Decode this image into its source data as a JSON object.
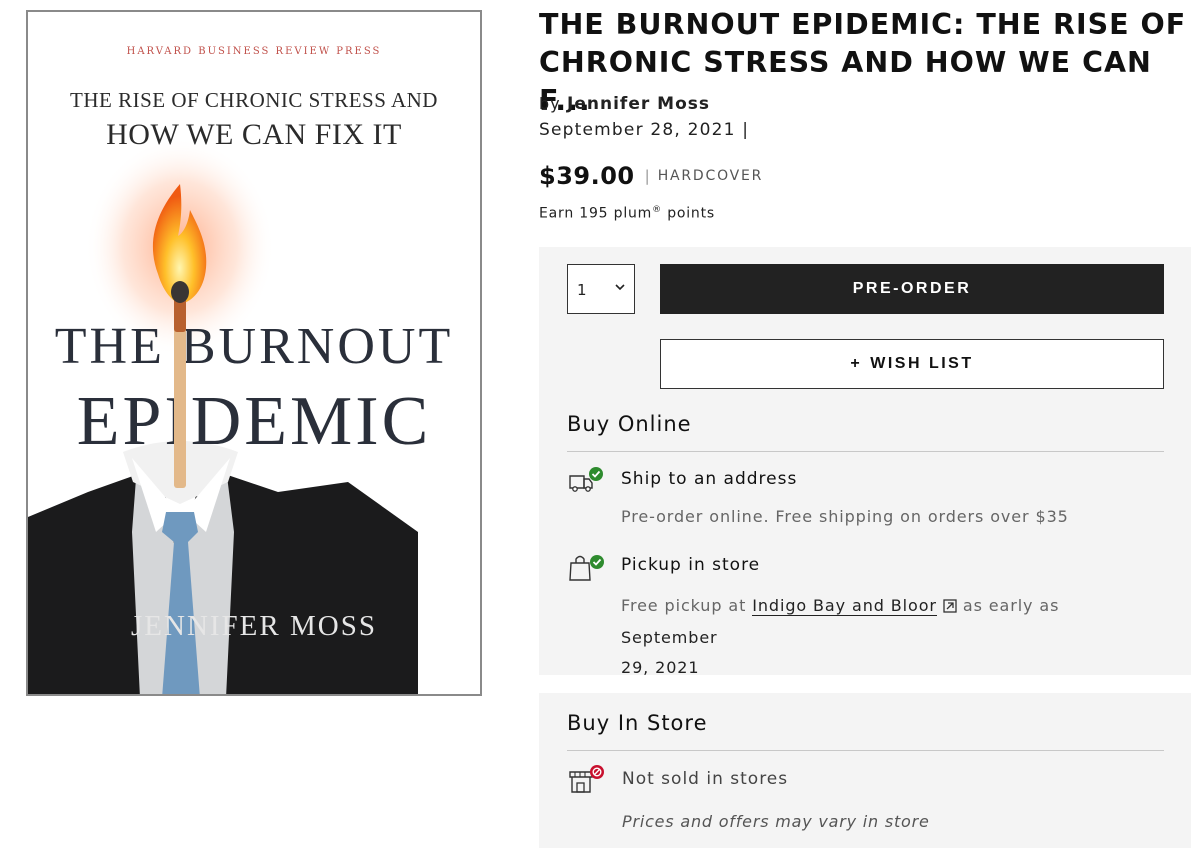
{
  "cover": {
    "publisher": "HARVARD BUSINESS REVIEW PRESS",
    "subtitle_line1": "THE RISE OF CHRONIC STRESS AND",
    "subtitle_line2": "HOW WE CAN FIX IT",
    "title_line1": "THE BURNOUT",
    "title_line2": "EPIDEMIC",
    "author": "JENNIFER MOSS"
  },
  "product": {
    "title": "THE BURNOUT EPIDEMIC: THE RISE OF CHRONIC STRESS AND HOW WE CAN F...",
    "by_label": "by",
    "author": "Jennifer Moss",
    "date": "September 28, 2021 |",
    "price": "$39.00",
    "price_separator": "|",
    "format": "HARDCOVER",
    "points_prefix": "Earn 195 plum",
    "points_registered": "®",
    "points_suffix": " points"
  },
  "purchase": {
    "quantity": "1",
    "preorder_label": "PRE-ORDER",
    "wishlist_plus": "+",
    "wishlist_label": "WISH LIST"
  },
  "buy_online": {
    "heading": "Buy Online",
    "ship": {
      "icon": "truck-check-icon",
      "label": "Ship to an address",
      "description": "Pre-order online. Free shipping on orders over $35"
    },
    "pickup": {
      "icon": "bag-check-icon",
      "label": "Pickup in store",
      "desc_prefix": "Free pickup at ",
      "store_name": "Indigo Bay and Bloor",
      "desc_mid": "as early as ",
      "desc_date_line1": "September",
      "desc_date_line2": "29, 2021"
    }
  },
  "buy_in_store": {
    "heading": "Buy In Store",
    "status": {
      "icon": "store-blocked-icon",
      "label": "Not sold in stores"
    },
    "note": "Prices and offers may vary in store"
  },
  "colors": {
    "button_dark": "#222222",
    "check_green": "#2e8b2e",
    "blocked_red": "#c8102e",
    "panel_bg": "#f4f4f4"
  }
}
